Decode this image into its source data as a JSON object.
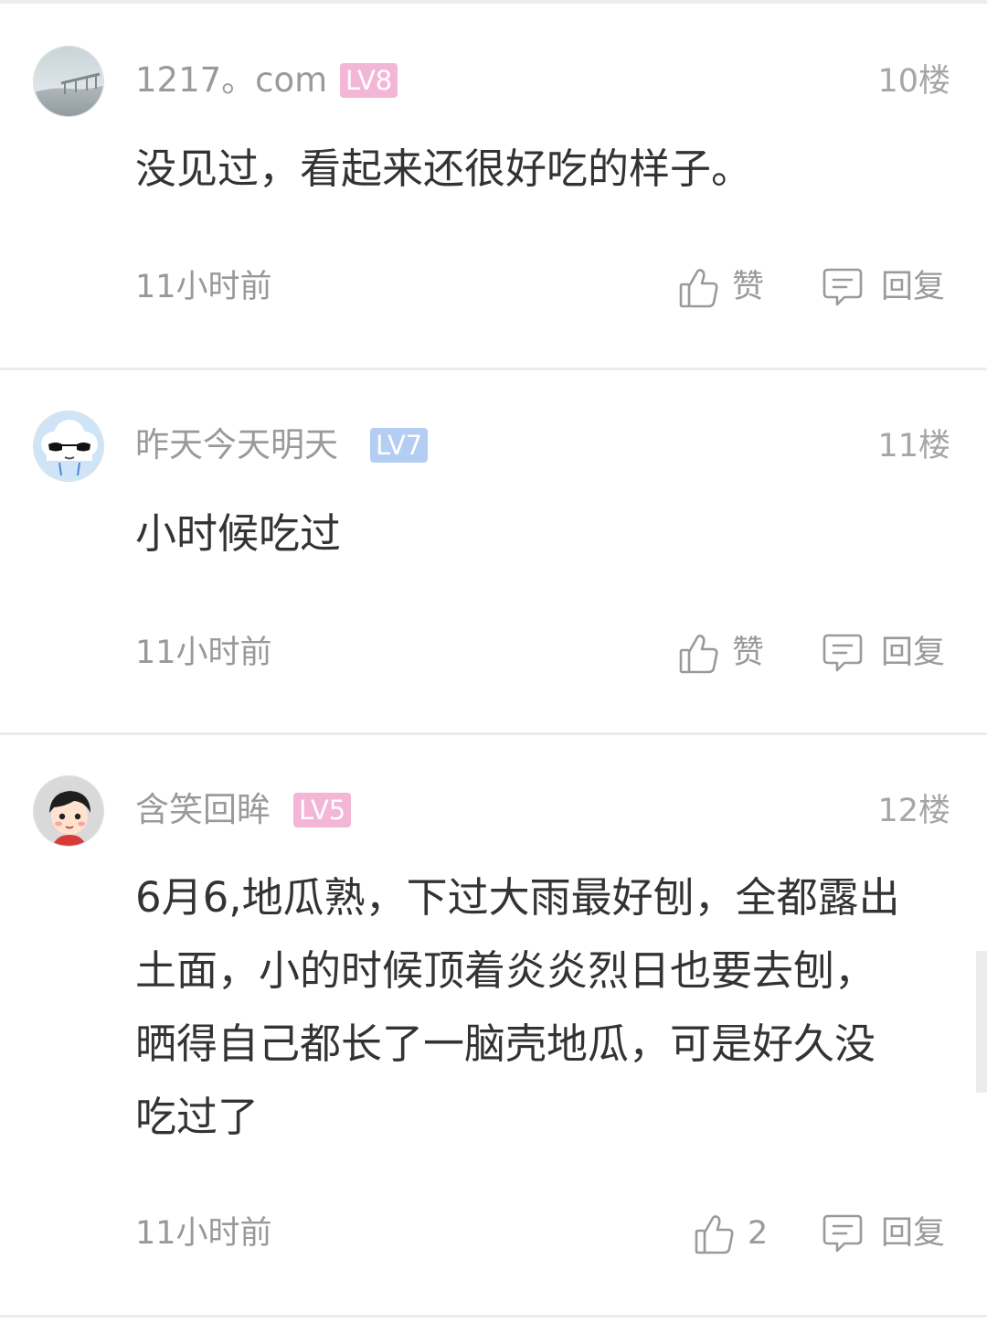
{
  "comments": [
    {
      "username": "1217。com",
      "level": "LV8",
      "level_color": "#f4b6d6",
      "floor": "10楼",
      "text": "没见过，看起来还很好吃的样子。",
      "time": "11小时前",
      "like_label": "赞",
      "reply_label": "回复",
      "avatar_icon": "foggy-bridge-photo"
    },
    {
      "username": "昨天今天明天",
      "level": "LV7",
      "level_color": "#b4cdf2",
      "floor": "11楼",
      "text": "小时候吃过",
      "time": "11小时前",
      "like_label": "赞",
      "reply_label": "回复",
      "avatar_icon": "cloud-sunglasses-cartoon"
    },
    {
      "username": "含笑回眸",
      "level": "LV5",
      "level_color": "#f4b6d6",
      "floor": "12楼",
      "text": "6月6,地瓜熟，下过大雨最好刨，全都露出土面，小的时候顶着炎炎烈日也要去刨，晒得自己都长了一脑壳地瓜，可是好久没吃过了",
      "time": "11小时前",
      "like_label": "2",
      "reply_label": "回复",
      "avatar_icon": "cartoon-child-face"
    }
  ],
  "icons": {
    "like": "thumbs-up-icon",
    "reply": "speech-bubble-icon"
  },
  "colors": {
    "secondary_text": "#9a9a9a",
    "primary_text": "#333333",
    "divider": "#ececec"
  }
}
